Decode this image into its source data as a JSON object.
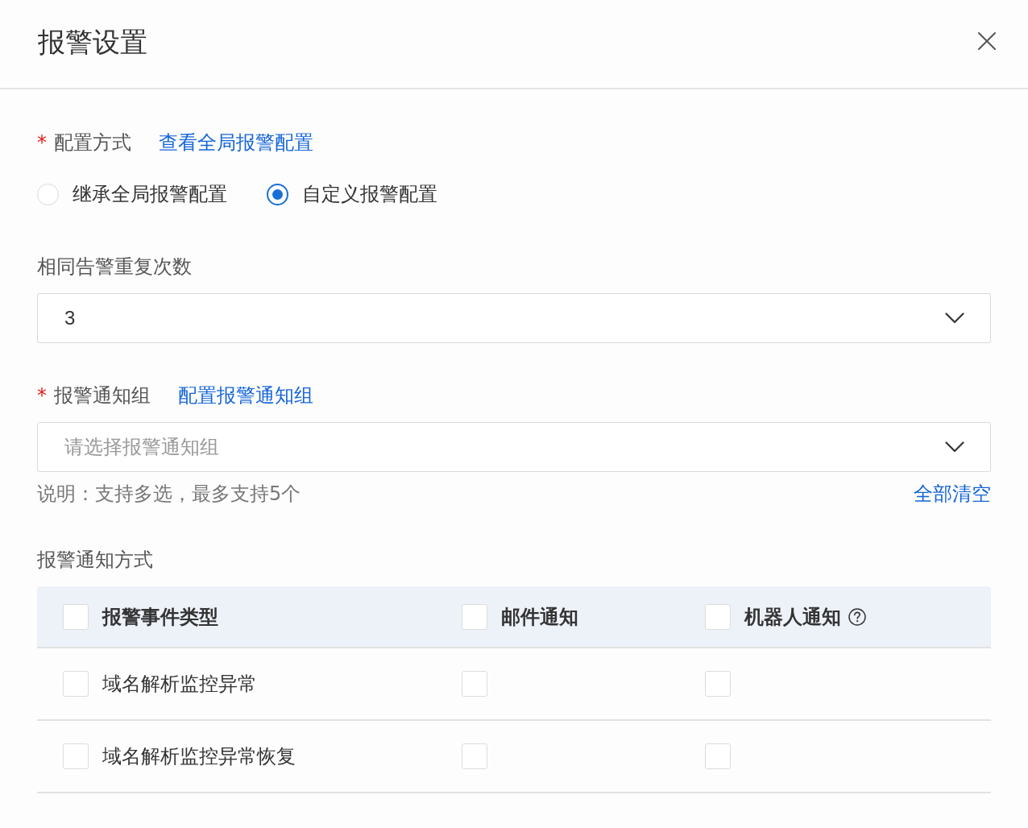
{
  "dialog": {
    "title": "报警设置"
  },
  "config_mode": {
    "required_mark": "*",
    "label": "配置方式",
    "link": "查看全局报警配置",
    "options": [
      {
        "label": "继承全局报警配置",
        "selected": false
      },
      {
        "label": "自定义报警配置",
        "selected": true
      }
    ]
  },
  "repeat_count": {
    "label": "相同告警重复次数",
    "value": "3"
  },
  "notify_group": {
    "required_mark": "*",
    "label": "报警通知组",
    "link": "配置报警通知组",
    "placeholder": "请选择报警通知组",
    "help": "说明：支持多选，最多支持5个",
    "clear_link": "全部清空"
  },
  "notify_methods": {
    "label": "报警通知方式",
    "table": {
      "columns": [
        {
          "label": "报警事件类型",
          "checked": false
        },
        {
          "label": "邮件通知",
          "checked": false
        },
        {
          "label": "机器人通知",
          "checked": false,
          "help": true
        }
      ],
      "rows": [
        {
          "event": "域名解析监控异常",
          "checked": false,
          "email_checked": false,
          "robot_checked": false
        },
        {
          "event": "域名解析监控异常恢复",
          "checked": false,
          "email_checked": false,
          "robot_checked": false
        }
      ]
    }
  }
}
